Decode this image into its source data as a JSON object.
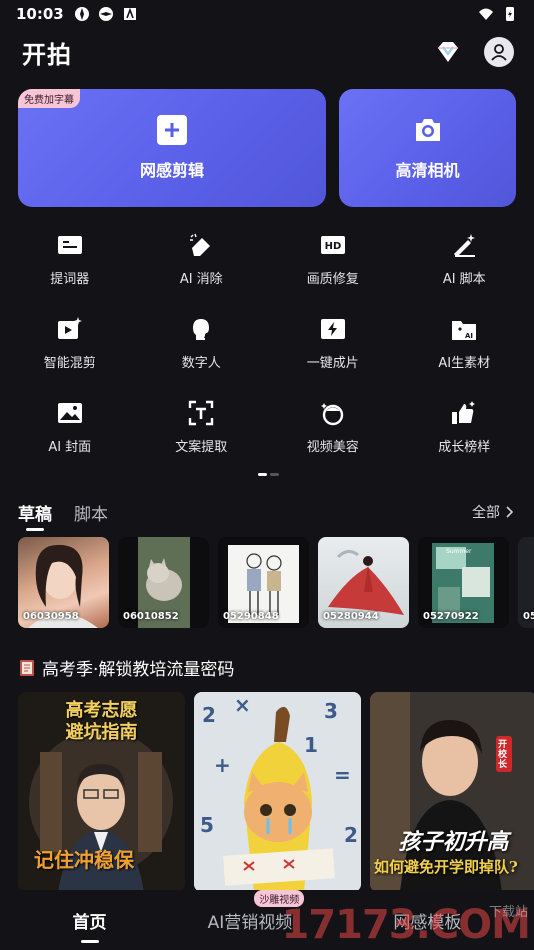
{
  "status": {
    "time": "10:03"
  },
  "header": {
    "title": "开拍"
  },
  "hero": {
    "left": {
      "label": "网感剪辑",
      "badge": "免费加字幕"
    },
    "right": {
      "label": "高清相机"
    }
  },
  "tools": [
    {
      "label": "提词器",
      "icon": "teleprompter-icon"
    },
    {
      "label": "AI 消除",
      "icon": "eraser-icon"
    },
    {
      "label": "画质修复",
      "icon": "hd-icon"
    },
    {
      "label": "AI 脚本",
      "icon": "magic-pen-icon"
    },
    {
      "label": "智能混剪",
      "icon": "smart-mix-icon"
    },
    {
      "label": "数字人",
      "icon": "digital-human-icon"
    },
    {
      "label": "一键成片",
      "icon": "lightning-icon"
    },
    {
      "label": "AI生素材",
      "icon": "ai-material-icon"
    },
    {
      "label": "AI 封面",
      "icon": "cover-image-icon"
    },
    {
      "label": "文案提取",
      "icon": "text-extract-icon"
    },
    {
      "label": "视频美容",
      "icon": "beauty-icon"
    },
    {
      "label": "成长榜样",
      "icon": "thumbs-up-icon"
    }
  ],
  "tabs": {
    "drafts": "草稿",
    "scripts": "脚本",
    "all": "全部"
  },
  "drafts": [
    {
      "label": "06030958"
    },
    {
      "label": "06010852"
    },
    {
      "label": "05290848"
    },
    {
      "label": "05280944"
    },
    {
      "label": "05270922"
    },
    {
      "label": "05"
    }
  ],
  "section": {
    "title": "高考季·解锁教培流量密码"
  },
  "templates": [
    {
      "top_text": "高考志愿\n避坑指南",
      "bottom_text": "记住冲稳保"
    },
    {
      "top_text": "",
      "bottom_text": ""
    },
    {
      "badge": "开校长",
      "bottom_text": "孩子初升高",
      "sub_text": "如何避免开学即掉队?"
    }
  ],
  "bottom_nav": {
    "home": "首页",
    "ai_video": "AI营销视频",
    "ai_badge": "沙雕视频",
    "templates": "网感模板"
  },
  "watermark": "17173.COM",
  "watermark_sub": "下载站",
  "colors": {
    "accent": "#5a5fe8",
    "background": "#121217",
    "badge_pink": "#f6c6d6"
  }
}
